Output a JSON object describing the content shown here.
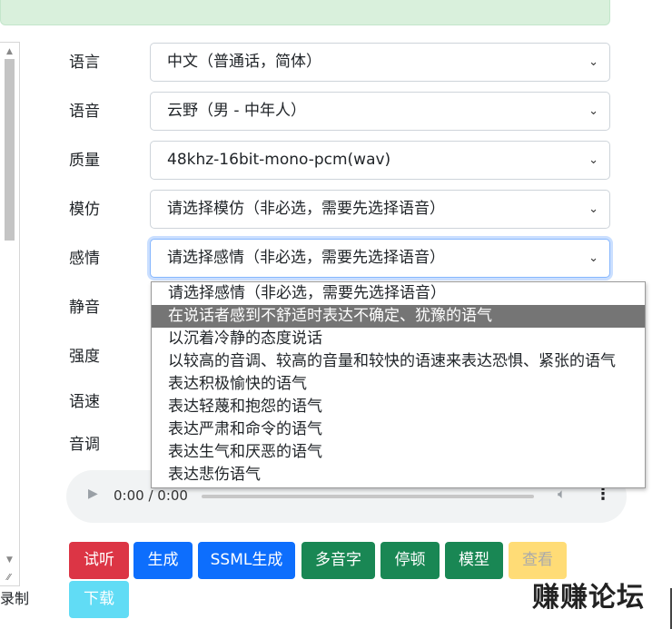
{
  "form": {
    "language": {
      "label": "语言",
      "value": "中文（普通话，简体）"
    },
    "voice": {
      "label": "语音",
      "value": "云野（男 - 中年人）"
    },
    "quality": {
      "label": "质量",
      "value": "48khz-16bit-mono-pcm(wav)"
    },
    "imitate": {
      "label": "模仿",
      "value": "请选择模仿（非必选，需要先选择语音）"
    },
    "emotion": {
      "label": "感情",
      "value": "请选择感情（非必选，需要先选择语音）"
    },
    "silence": {
      "label": "静音"
    },
    "strength": {
      "label": "强度"
    },
    "rate": {
      "label": "语速"
    },
    "pitch": {
      "label": "音调"
    }
  },
  "emotion_options": [
    "请选择感情（非必选，需要先选择语音）",
    "在说话者感到不舒适时表达不确定、犹豫的语气",
    "以沉着冷静的态度说话",
    "以较高的音调、较高的音量和较快的语速来表达恐惧、紧张的语气",
    "表达积极愉快的语气",
    "表达轻蔑和抱怨的语气",
    "表达严肃和命令的语气",
    "表达生气和厌恶的语气",
    "表达悲伤语气"
  ],
  "emotion_highlighted_index": 1,
  "audio": {
    "time": "0:00 / 0:00",
    "play_icon": "play-icon",
    "volume_icon": "volume-icon",
    "menu_icon": "more-vert-icon"
  },
  "buttons": {
    "listen": "试听",
    "generate": "生成",
    "ssml_generate": "SSML生成",
    "polyphone": "多音字",
    "pause": "停顿",
    "model": "模型",
    "view": "查看",
    "download": "下载"
  },
  "left_cut_text": "录制",
  "watermark": "赚赚论坛",
  "colors": {
    "alert_bg": "#d9f0dc",
    "btn_red": "#dc3545",
    "btn_blue": "#0d6efd",
    "btn_green": "#198754",
    "btn_yellow": "#ffc107",
    "btn_cyan": "#0dcaf0",
    "highlight": "#757575"
  }
}
